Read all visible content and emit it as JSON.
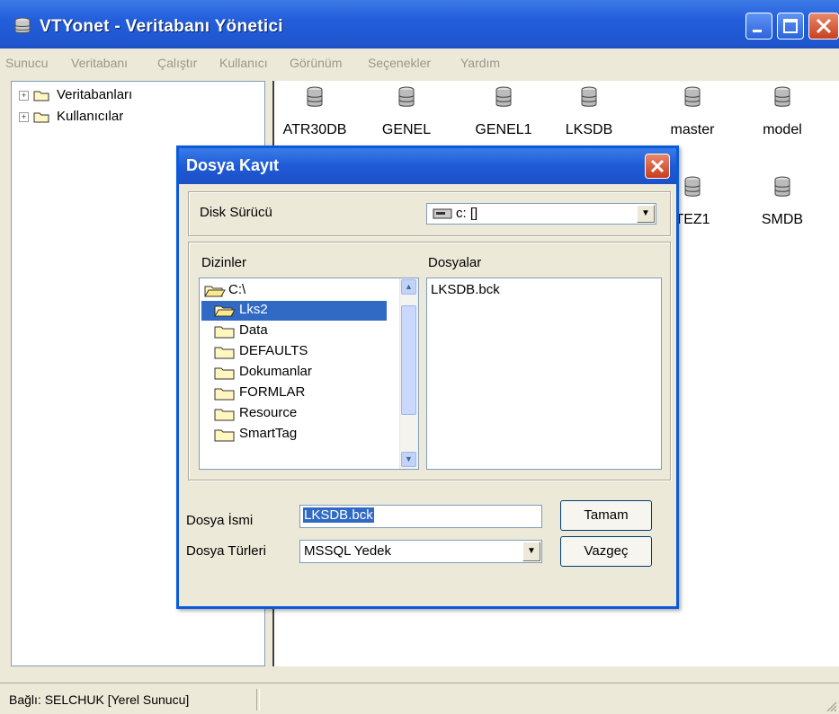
{
  "window": {
    "title": "VTYonet - Veritabanı Yönetici"
  },
  "menu": [
    "Sunucu",
    "Veritabanı",
    "Çalıştır",
    "Kullanıcı",
    "Görünüm",
    "Seçenekler",
    "Yardım"
  ],
  "tree": {
    "items": [
      "Veritabanları",
      "Kullanıcılar"
    ]
  },
  "databases": [
    "ATR30DB",
    "GENEL",
    "GENEL1",
    "LKSDB",
    "master",
    "model",
    "TEZ1",
    "SMDB"
  ],
  "dialog": {
    "title": "Dosya Kayıt",
    "disk_label": "Disk Sürücü",
    "disk_value": "c: []",
    "dirs_label": "Dizinler",
    "files_label": "Dosyalar",
    "dirs": [
      "C:\\",
      "Lks2",
      "Data",
      "DEFAULTS",
      "Dokumanlar",
      "FORMLAR",
      "Resource",
      "SmartTag"
    ],
    "selected_dir": "Lks2",
    "files": [
      "LKSDB.bck"
    ],
    "filename_label": "Dosya İsmi",
    "filename_value": "LKSDB.bck",
    "filetype_label": "Dosya Türleri",
    "filetype_value": "MSSQL Yedek",
    "ok_label": "Tamam",
    "cancel_label": "Vazgeç"
  },
  "status": {
    "text": "Bağlı: SELCHUK [Yerel Sunucu]"
  },
  "colors": {
    "title_bar": "#245edb",
    "selection": "#316ac5",
    "close_button": "#c93f1f"
  }
}
